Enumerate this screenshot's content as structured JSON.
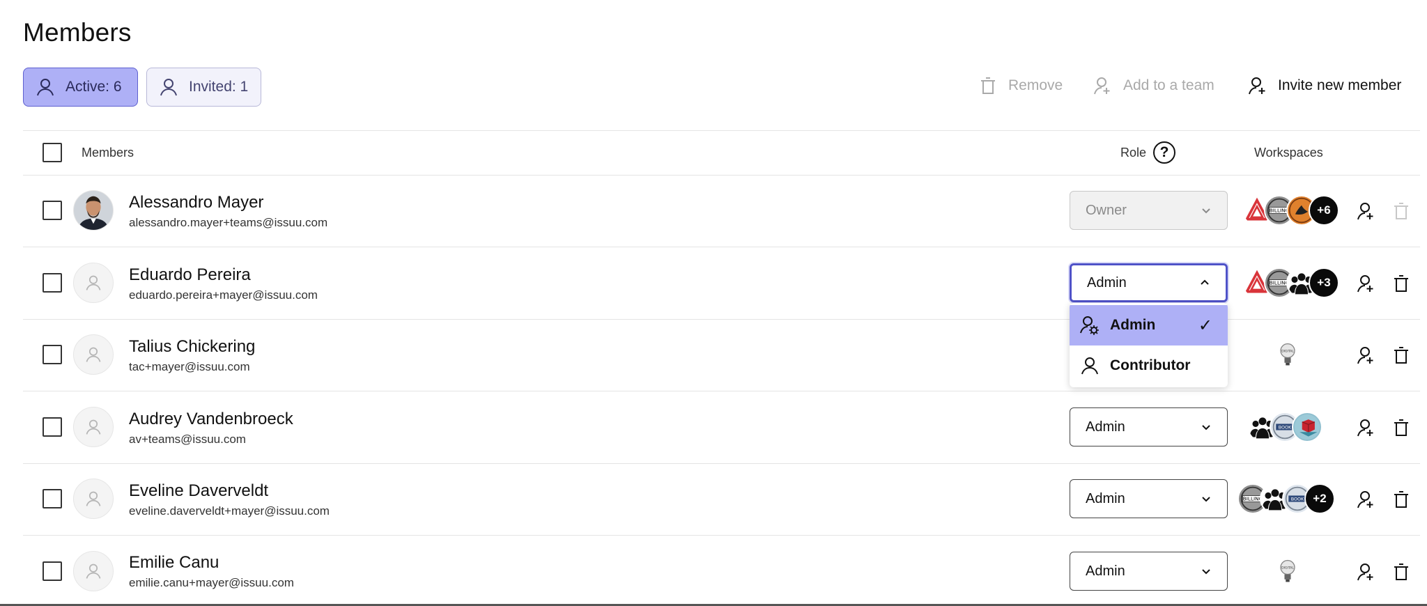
{
  "page": {
    "title": "Members"
  },
  "tabs": [
    {
      "label": "Active: 6",
      "icon": "user-icon",
      "state": "active"
    },
    {
      "label": "Invited: 1",
      "icon": "user-icon",
      "state": "inactive"
    }
  ],
  "actions": {
    "remove": {
      "label": "Remove",
      "icon": "trash-icon",
      "enabled": false
    },
    "add_to_team": {
      "label": "Add to a team",
      "icon": "user-search-icon",
      "enabled": false
    },
    "invite": {
      "label": "Invite new member",
      "icon": "user-plus-icon",
      "enabled": true
    }
  },
  "table": {
    "headers": {
      "members": "Members",
      "role": "Role",
      "workspaces": "Workspaces"
    },
    "help_icon": "question-icon",
    "rows": [
      {
        "name": "Alessandro Mayer",
        "email": "alessandro.mayer+teams@issuu.com",
        "role": "Owner",
        "role_disabled": true,
        "avatar": "photo",
        "workspaces": [
          "triangle-logo",
          "billing-logo",
          "orange-seal-logo"
        ],
        "more": "+6"
      },
      {
        "name": "Eduardo Pereira",
        "email": "eduardo.pereira+mayer@issuu.com",
        "role": "Admin",
        "role_open": true,
        "avatar": "user-icon",
        "workspaces": [
          "triangle-logo",
          "billing-logo",
          "people-logo"
        ],
        "more": "+3"
      },
      {
        "name": "Talius Chickering",
        "email": "tac+mayer@issuu.com",
        "role": "",
        "avatar": "user-icon",
        "workspaces": [
          "lightbulb-logo"
        ],
        "more": ""
      },
      {
        "name": "Audrey Vandenbroeck",
        "email": "av+teams@issuu.com",
        "role": "Admin",
        "avatar": "user-icon",
        "workspaces": [
          "people-logo",
          "badge-logo",
          "cube-logo"
        ],
        "more": ""
      },
      {
        "name": "Eveline Daverveldt",
        "email": "eveline.daverveldt+mayer@issuu.com",
        "role": "Admin",
        "avatar": "user-icon",
        "workspaces": [
          "billing-logo",
          "people-logo",
          "badge-logo"
        ],
        "more": "+2"
      },
      {
        "name": "Emilie Canu",
        "email": "emilie.canu+mayer@issuu.com",
        "role": "Admin",
        "avatar": "user-icon",
        "workspaces": [
          "lightbulb-logo"
        ],
        "more": ""
      }
    ]
  },
  "role_menu": {
    "items": [
      {
        "label": "Admin",
        "icon": "user-gear-icon",
        "selected": true,
        "check": "✓"
      },
      {
        "label": "Contributor",
        "icon": "user-icon",
        "selected": false
      }
    ]
  },
  "colors": {
    "accent": "#aeb0f6",
    "accent_border": "#5d5fcf",
    "focus": "#4f52c8"
  }
}
